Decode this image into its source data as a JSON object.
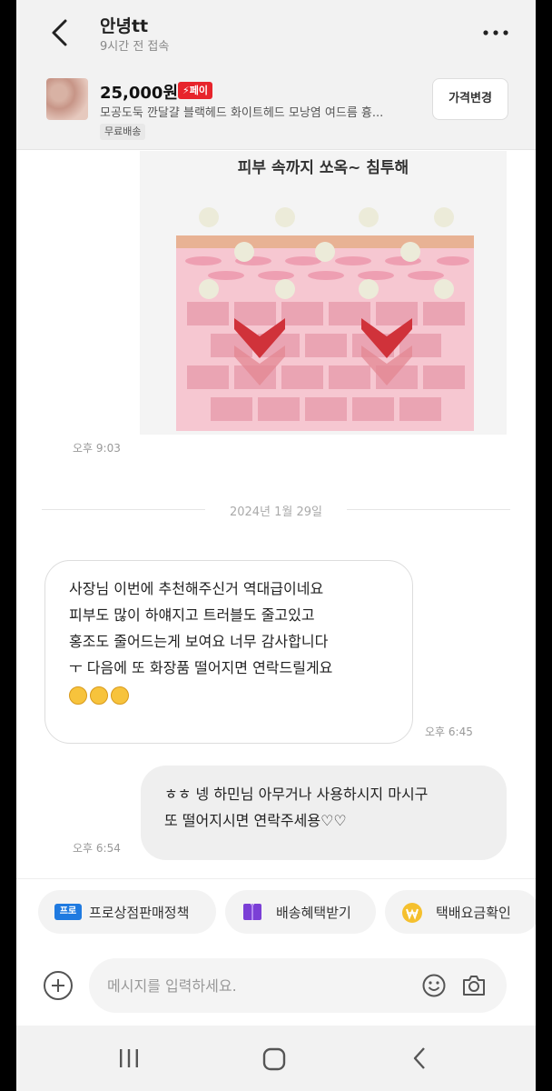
{
  "header": {
    "user_name": "안녕tt",
    "last_seen": "9시간 전 접속"
  },
  "product": {
    "price": "25,000원",
    "pay_badge": "⚡페이",
    "title": "모공도둑 깐달걀 블랙헤드 화이트헤드 모낭염 여드름 흉...",
    "shipping": "무료배송",
    "price_change_button": "가격변경"
  },
  "messages": {
    "image_caption": "피부 속까지 쏘옥~ 침투해",
    "image_time": "오후 9:03",
    "date_separator": "2024년 1월 29일",
    "incoming": {
      "lines": [
        "사장님 이번에 추천해주신거 역대급이네요",
        "피부도 많이 하얘지고 트러블도 줄고있고",
        "홍조도 줄어드는게 보여요  너무 감사합니다",
        "ㅜ 다음에 또 화장품 떨어지면 연락드릴게요"
      ],
      "emoji": "😊😊😊",
      "time": "오후 6:45"
    },
    "outgoing": {
      "lines": [
        "ㅎㅎ 넹 하민님 아무거나 사용하시지 마시구",
        "또 떨어지시면 연락주세용♡♡"
      ],
      "time": "오후 6:54"
    }
  },
  "chips": [
    {
      "label": "프로상점판매정책",
      "icon": "pro-badge-icon",
      "icon_text": "프로"
    },
    {
      "label": "배송혜택받기",
      "icon": "delivery-box-icon"
    },
    {
      "label": "택배요금확인",
      "icon": "won-coin-icon"
    }
  ],
  "composer": {
    "placeholder": "메시지를 입력하세요."
  },
  "colors": {
    "accent_red": "#e7242c",
    "skin_pink": "#f3b9c5",
    "arrow_red": "#d0323a"
  }
}
